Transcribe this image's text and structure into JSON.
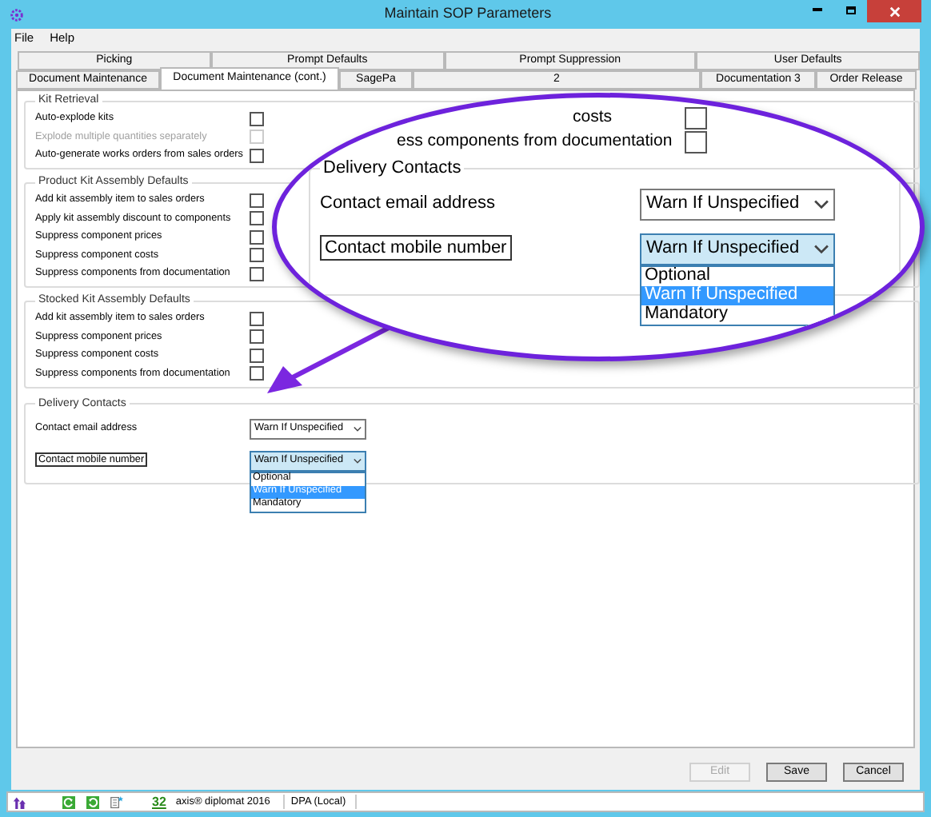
{
  "window": {
    "title": "Maintain SOP Parameters"
  },
  "menu": [
    "File",
    "Help"
  ],
  "tabs_row_1": [
    {
      "label": "Picking",
      "selected": false
    },
    {
      "label": "Prompt Defaults",
      "selected": false
    },
    {
      "label": "Prompt Suppression",
      "selected": false
    },
    {
      "label": "User Defaults",
      "selected": false
    }
  ],
  "tabs_row_2": [
    {
      "label": "Document Maintenance",
      "selected": false
    },
    {
      "label": "Document Maintenance (cont.)",
      "selected": true
    },
    {
      "label": "SagePa",
      "selected": false
    },
    {
      "label": "2",
      "selected": false
    },
    {
      "label": "Documentation 3",
      "selected": false
    },
    {
      "label": "Order Release",
      "selected": false
    }
  ],
  "groups": [
    {
      "title": "Kit Retrieval",
      "items": [
        {
          "label": "Auto-explode kits",
          "disabled": false,
          "checked": false
        },
        {
          "label": "Explode multiple quantities separately",
          "disabled": true,
          "checked": false
        },
        {
          "label": "Auto-generate works orders from sales orders",
          "disabled": false,
          "checked": false
        }
      ]
    },
    {
      "title": "Product Kit Assembly Defaults",
      "items": [
        {
          "label": "Add kit assembly item to sales orders",
          "disabled": false,
          "checked": false
        },
        {
          "label": "Apply kit assembly discount to components",
          "disabled": false,
          "checked": false
        },
        {
          "label": "Suppress component prices",
          "disabled": false,
          "checked": false
        },
        {
          "label": "Suppress component costs",
          "disabled": false,
          "checked": false
        },
        {
          "label": "Suppress components from documentation",
          "disabled": false,
          "checked": false
        }
      ]
    },
    {
      "title": "Stocked Kit Assembly Defaults",
      "items": [
        {
          "label": "Add kit assembly item to sales orders",
          "disabled": false,
          "checked": false
        },
        {
          "label": "Suppress component prices",
          "disabled": false,
          "checked": false
        },
        {
          "label": "Suppress component costs",
          "disabled": false,
          "checked": false
        },
        {
          "label": "Suppress components from documentation",
          "disabled": false,
          "checked": false
        }
      ]
    }
  ],
  "delivery_contacts": {
    "title": "Delivery Contacts",
    "fields": [
      {
        "label": "Contact email address",
        "value": "Warn If Unspecified",
        "focused": false
      },
      {
        "label": "Contact mobile number",
        "value": "Warn If Unspecified",
        "focused": true,
        "options": [
          {
            "label": "Optional",
            "selected": false
          },
          {
            "label": "Warn If Unspecified",
            "selected": true
          },
          {
            "label": "Mandatory",
            "selected": false
          }
        ]
      }
    ]
  },
  "callout": {
    "rows": [
      {
        "label": "costs",
        "checked": false
      },
      {
        "label": "ess components from documentation",
        "checked": false
      }
    ],
    "title": "Delivery Contacts",
    "fields": [
      {
        "label": "Contact email address",
        "value": "Warn If Unspecified",
        "focused": false
      },
      {
        "label": "Contact mobile number",
        "value": "Warn If Unspecified",
        "focused": true,
        "options": [
          {
            "label": "Optional",
            "selected": false
          },
          {
            "label": "Warn If Unspecified",
            "selected": true
          },
          {
            "label": "Mandatory",
            "selected": false
          }
        ]
      }
    ]
  },
  "buttons": [
    {
      "label": "Edit",
      "disabled": true
    },
    {
      "label": "Save",
      "disabled": false
    },
    {
      "label": "Cancel",
      "disabled": false
    }
  ],
  "status_bar": {
    "count": "32",
    "product": "axis® diplomat 2016",
    "database": "DPA (Local)"
  }
}
